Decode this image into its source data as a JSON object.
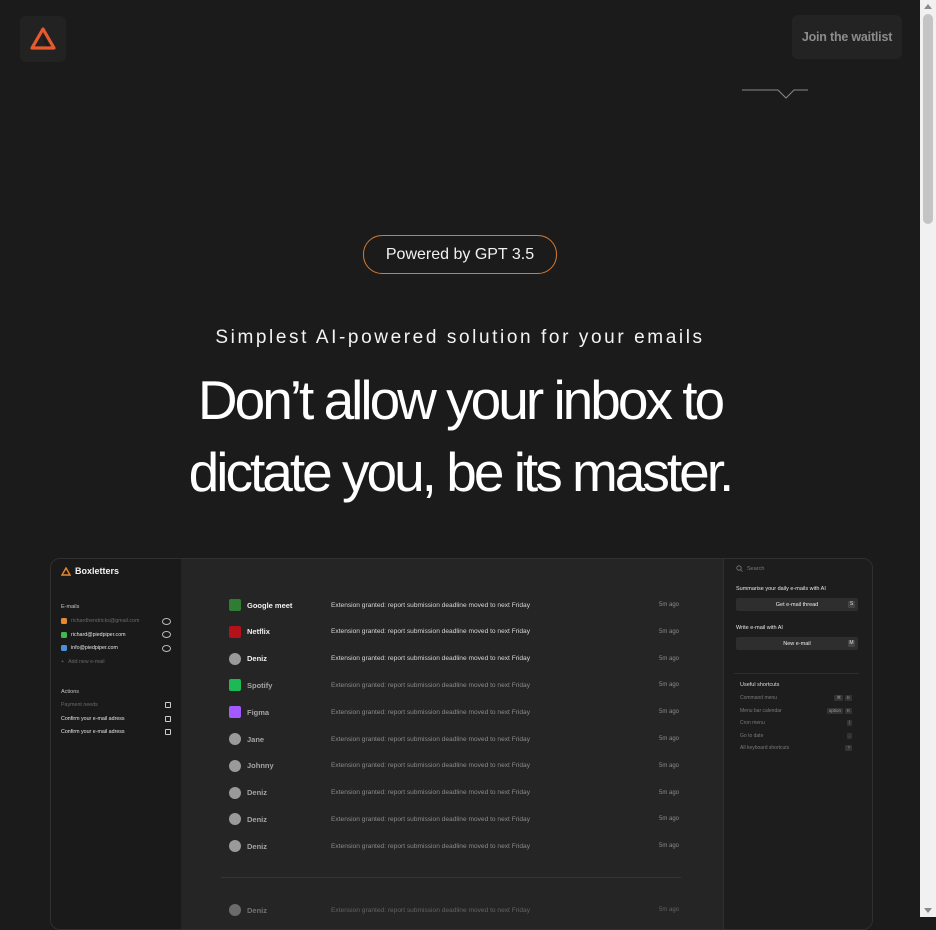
{
  "nav": {
    "waitlist_label": "Join the waitlist",
    "brand_color": "#e65a2e"
  },
  "hero": {
    "badge": "Powered by GPT 3.5",
    "subtitle": "Simplest AI-powered solution for your emails",
    "headline_line1": "Don’t allow your inbox to",
    "headline_line2": "dictate you, be its master.",
    "badge_border_color": "#d57a32"
  },
  "app": {
    "brand": "Boxletters",
    "sidebar": {
      "emails_label": "E-mails",
      "emails": [
        {
          "address": "richardhendricks@gmail.com",
          "color": "#e8892e",
          "icon": "eye-off-icon",
          "dim": true
        },
        {
          "address": "richard@piedpiper.com",
          "color": "#3fb950",
          "icon": "eye-icon",
          "dim": false
        },
        {
          "address": "info@piedpiper.com",
          "color": "#4a90d9",
          "icon": "eye-icon",
          "dim": false
        }
      ],
      "add_email": "Add new e-mail",
      "actions_label": "Actions",
      "actions": [
        {
          "label": "Payment needs",
          "dim": true
        },
        {
          "label": "Confirm your e-mail adress",
          "dim": false
        },
        {
          "label": "Confirm your e-mail adress",
          "dim": false
        }
      ]
    },
    "emails": [
      {
        "sender": "Google meet",
        "subject": "Extension granted: report submission deadline moved to next Friday",
        "time": "5m ago",
        "read": false,
        "icon": "google-meet-icon"
      },
      {
        "sender": "Netflix",
        "subject": "Extension granted: report submission deadline moved to next Friday",
        "time": "5m ago",
        "read": false,
        "icon": "netflix-icon"
      },
      {
        "sender": "Deniz",
        "subject": "Extension granted: report submission deadline moved to next Friday",
        "time": "5m ago",
        "read": false,
        "icon": "avatar-icon"
      },
      {
        "sender": "Spotify",
        "subject": "Extension granted: report submission deadline moved to next Friday",
        "time": "5m ago",
        "read": true,
        "icon": "spotify-icon"
      },
      {
        "sender": "Figma",
        "subject": "Extension granted: report submission deadline moved to next Friday",
        "time": "5m ago",
        "read": true,
        "icon": "figma-icon"
      },
      {
        "sender": "Jane",
        "subject": "Extension granted: report submission deadline moved to next Friday",
        "time": "5m ago",
        "read": true,
        "icon": "avatar-icon"
      },
      {
        "sender": "Johnny",
        "subject": "Extension granted: report submission deadline moved to next Friday",
        "time": "5m ago",
        "read": true,
        "icon": "avatar-icon"
      },
      {
        "sender": "Deniz",
        "subject": "Extension granted: report submission deadline moved to next Friday",
        "time": "5m ago",
        "read": true,
        "icon": "avatar-icon"
      },
      {
        "sender": "Deniz",
        "subject": "Extension granted: report submission deadline moved to next Friday",
        "time": "5m ago",
        "read": true,
        "icon": "avatar-icon"
      },
      {
        "sender": "Deniz",
        "subject": "Extension granted: report submission deadline moved to next Friday",
        "time": "5m ago",
        "read": true,
        "icon": "avatar-icon"
      },
      {
        "sender": "Deniz",
        "subject": "Extension granted: report submission deadline moved to next Friday",
        "time": "5m ago",
        "read": true,
        "icon": "avatar-icon"
      }
    ],
    "right": {
      "search_placeholder": "Search",
      "summarise_title": "Summarise your daily e-mails with AI",
      "summarise_button": "Get e-mail thread",
      "summarise_key": "S",
      "write_title": "Write e-mail with AI",
      "write_button": "New e-mail",
      "write_key": "M",
      "shortcuts_title": "Useful shortcuts",
      "shortcuts": [
        {
          "label": "Command menu",
          "keys": [
            "⌘",
            "K"
          ]
        },
        {
          "label": "Menu bar calendar",
          "keys": [
            "option",
            "K"
          ]
        },
        {
          "label": "Cron menu",
          "keys": [
            "/"
          ]
        },
        {
          "label": "Go to date",
          "keys": [
            "."
          ]
        },
        {
          "label": "All keyboard shortcuts",
          "keys": [
            "?"
          ]
        }
      ]
    }
  }
}
